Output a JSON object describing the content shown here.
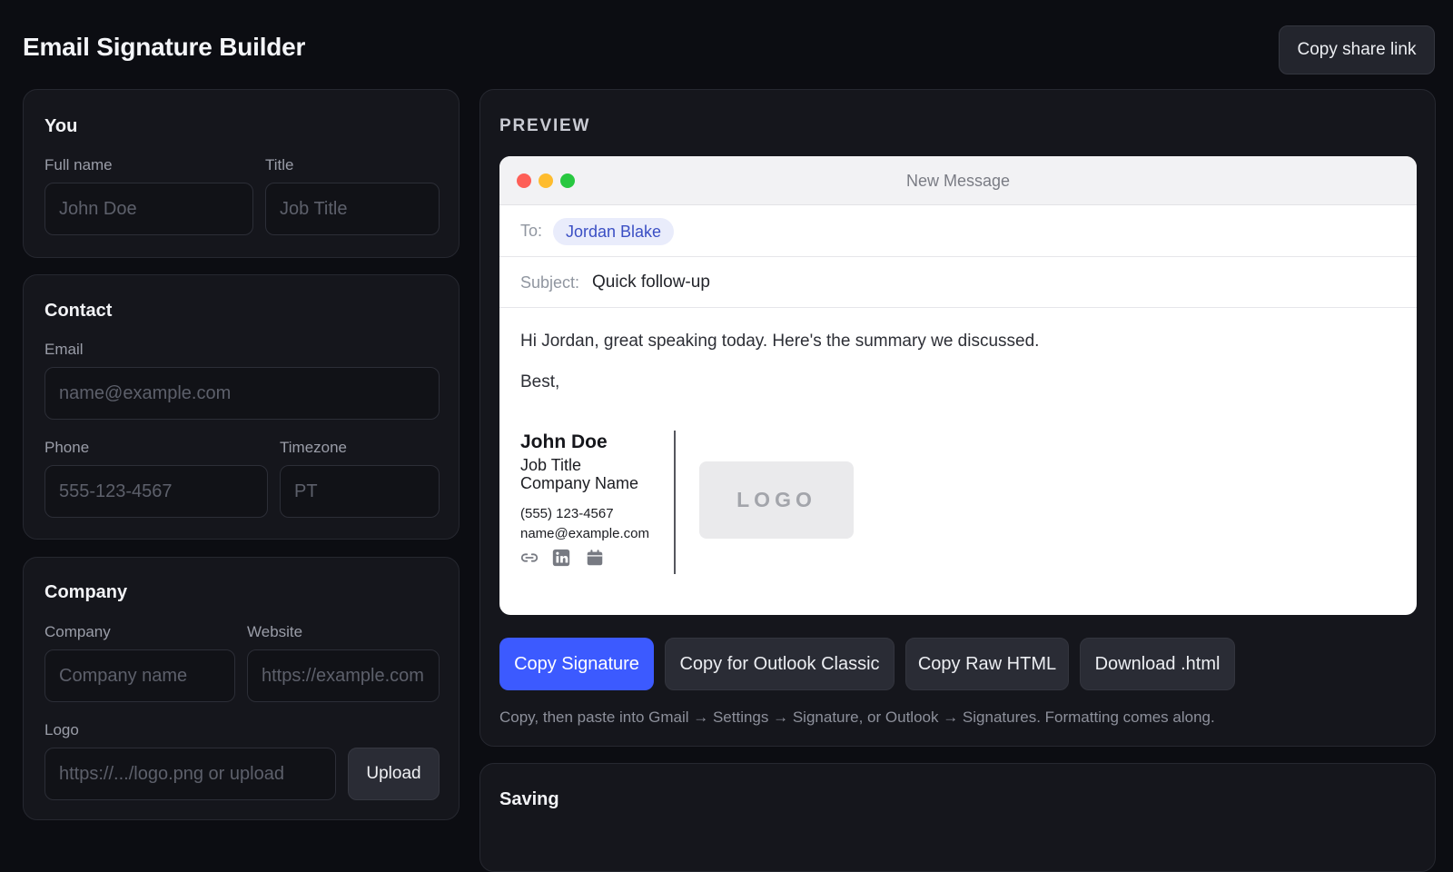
{
  "app": {
    "title": "Email Signature Builder",
    "share_label": "Copy share link"
  },
  "you": {
    "title": "You",
    "full_name_label": "Full name",
    "full_name_placeholder": "John Doe",
    "title_label": "Title",
    "title_placeholder": "Job Title"
  },
  "contact": {
    "title": "Contact",
    "email_label": "Email",
    "email_placeholder": "name@example.com",
    "phone_label": "Phone",
    "phone_placeholder": "555-123-4567",
    "timezone_label": "Timezone",
    "timezone_placeholder": "PT"
  },
  "company": {
    "title": "Company",
    "company_label": "Company",
    "company_placeholder": "Company name",
    "website_label": "Website",
    "website_placeholder": "https://example.com",
    "logo_label": "Logo",
    "logo_placeholder": "https://.../logo.png or upload",
    "upload_label": "Upload"
  },
  "preview": {
    "label": "PREVIEW",
    "window_title": "New Message",
    "to_label": "To:",
    "recipient": "Jordan Blake",
    "subject_label": "Subject:",
    "subject": "Quick follow-up",
    "body_line": "Hi Jordan, great speaking today. Here's the summary we discussed.",
    "closing": "Best,",
    "signature": {
      "name": "John Doe",
      "title": "Job Title",
      "company": "Company Name",
      "phone": "(555) 123-4567",
      "email": "name@example.com",
      "icons": [
        "link-icon",
        "linkedin-icon",
        "calendar-icon"
      ],
      "logo_text": "LOGO"
    }
  },
  "actions": {
    "copy_signature": "Copy Signature",
    "copy_outlook": "Copy for Outlook Classic",
    "copy_raw": "Copy Raw HTML",
    "download": "Download .html"
  },
  "hint": "Copy, then paste into Gmail → Settings → Signature, or Outlook → Signatures. Formatting comes along.",
  "saving": {
    "title": "Saving"
  },
  "colors": {
    "background": "#0c0d12",
    "card": "#15161c",
    "accent": "#3c5aff",
    "recipient_chip": "#e9ecfb",
    "dot_red": "#fe5f57",
    "dot_yellow": "#febc2e",
    "dot_green": "#28c840"
  }
}
